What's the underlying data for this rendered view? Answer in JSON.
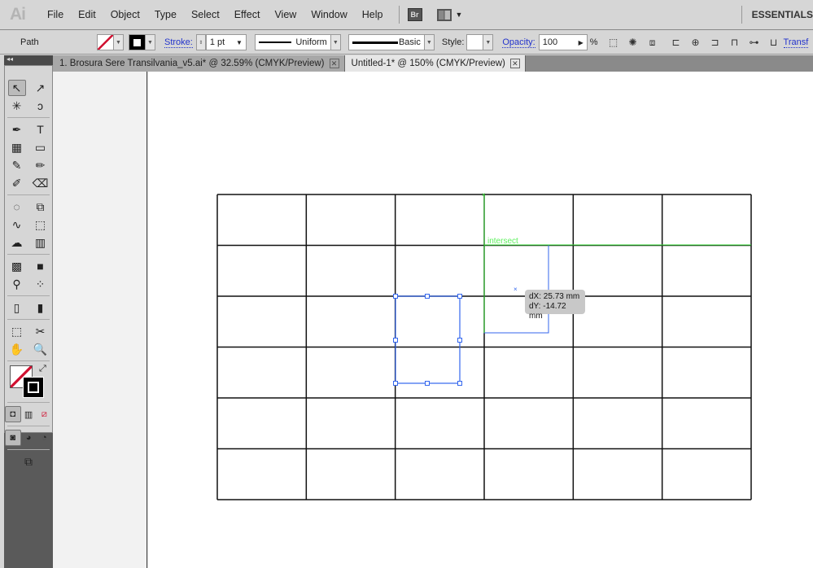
{
  "app": {
    "logo": "Ai",
    "menus": [
      "File",
      "Edit",
      "Object",
      "Type",
      "Select",
      "Effect",
      "View",
      "Window",
      "Help"
    ],
    "bridge": "Br",
    "workspace": "ESSENTIALS"
  },
  "control": {
    "selection": "Path",
    "stroke_label": "Stroke:",
    "stroke_weight": "1 pt",
    "profile": "Uniform",
    "brush": "Basic",
    "style_label": "Style:",
    "opacity_label": "Opacity:",
    "opacity": "100",
    "percent": "%",
    "transform": "Transf"
  },
  "tabs": [
    {
      "label": "1. Brosura Sere Transilvania_v5.ai* @ 32.59% (CMYK/Preview)",
      "active": false
    },
    {
      "label": "Untitled-1* @ 150% (CMYK/Preview)",
      "active": true
    }
  ],
  "panel": {
    "collapse": "◂◂"
  },
  "canvas": {
    "snap_hint": "intersect",
    "dx": "dX: 25.73 mm",
    "dy": "dY: -14.72 mm",
    "grid_columns": 6,
    "grid_rows": 6,
    "guide_color": "#33dd33",
    "selection_color": "#3366ee"
  },
  "tools": [
    [
      "↖",
      "↗"
    ],
    [
      "✳",
      "ↄ"
    ],
    [
      "✒",
      "T"
    ],
    [
      "▦",
      "▭"
    ],
    [
      "✎",
      "✏"
    ],
    [
      "✐",
      "⌫"
    ],
    [
      "◌",
      "⧉"
    ],
    [
      "∿",
      "⬚"
    ],
    [
      "☁",
      "▥"
    ],
    [
      "▩",
      "■"
    ],
    [
      "⚲",
      "⁘"
    ],
    [
      "▯",
      "▮"
    ],
    [
      "⬚",
      "✂"
    ],
    [
      "✋",
      "🔍"
    ]
  ]
}
